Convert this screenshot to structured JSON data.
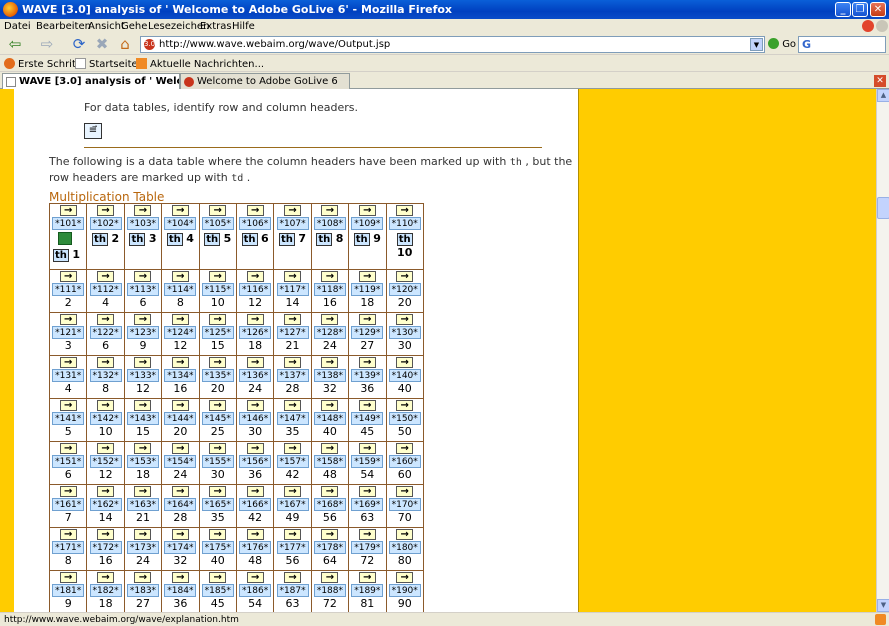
{
  "window": {
    "title": "WAVE [3.0] analysis of ' Welcome to Adobe GoLive 6' - Mozilla Firefox",
    "min": "_",
    "max": "❐",
    "close": "✕"
  },
  "menu": [
    "Datei",
    "Bearbeiten",
    "Ansicht",
    "Gehe",
    "Lesezeichen",
    "Extras",
    "Hilfe"
  ],
  "nav": {
    "back": "⇦",
    "forward": "⇨",
    "reload": "⟳",
    "stop": "✖",
    "home": "⌂",
    "url": "http://www.wave.webaim.org/wave/Output.jsp",
    "go_label": "Go",
    "search_logo": "G"
  },
  "bookmarks": [
    "Erste Schritte",
    "Startseite",
    "Aktuelle Nachrichten..."
  ],
  "tabs": [
    {
      "label": "WAVE [3.0] analysis of ' Welcome to A...",
      "active": true
    },
    {
      "label": "Welcome to Adobe GoLive 6",
      "active": false
    }
  ],
  "page": {
    "help_text": "For data tables, identify row and column headers.",
    "help_icon": "≡⃗",
    "para_before_th": "The following is a data table where the column headers have been marked up with ",
    "code_th": "th",
    "para_middle": " , but the row headers are marked up with ",
    "code_td": "td",
    "para_end": " .",
    "caption": "Multiplication Table",
    "arrow_glyph": "→",
    "th_label": "th",
    "header_row": {
      "ids": [
        "*101*",
        "*102*",
        "*103*",
        "*104*",
        "*105*",
        "*106*",
        "*107*",
        "*108*",
        "*109*",
        "*110*"
      ],
      "values": [
        "1",
        "2",
        "3",
        "4",
        "5",
        "6",
        "7",
        "8",
        "9",
        "10"
      ]
    },
    "rows": [
      {
        "ids": [
          "*111*",
          "*112*",
          "*113*",
          "*114*",
          "*115*",
          "*116*",
          "*117*",
          "*118*",
          "*119*",
          "*120*"
        ],
        "values": [
          "2",
          "4",
          "6",
          "8",
          "10",
          "12",
          "14",
          "16",
          "18",
          "20"
        ]
      },
      {
        "ids": [
          "*121*",
          "*122*",
          "*123*",
          "*124*",
          "*125*",
          "*126*",
          "*127*",
          "*128*",
          "*129*",
          "*130*"
        ],
        "values": [
          "3",
          "6",
          "9",
          "12",
          "15",
          "18",
          "21",
          "24",
          "27",
          "30"
        ]
      },
      {
        "ids": [
          "*131*",
          "*132*",
          "*133*",
          "*134*",
          "*135*",
          "*136*",
          "*137*",
          "*138*",
          "*139*",
          "*140*"
        ],
        "values": [
          "4",
          "8",
          "12",
          "16",
          "20",
          "24",
          "28",
          "32",
          "36",
          "40"
        ]
      },
      {
        "ids": [
          "*141*",
          "*142*",
          "*143*",
          "*144*",
          "*145*",
          "*146*",
          "*147*",
          "*148*",
          "*149*",
          "*150*"
        ],
        "values": [
          "5",
          "10",
          "15",
          "20",
          "25",
          "30",
          "35",
          "40",
          "45",
          "50"
        ]
      },
      {
        "ids": [
          "*151*",
          "*152*",
          "*153*",
          "*154*",
          "*155*",
          "*156*",
          "*157*",
          "*158*",
          "*159*",
          "*160*"
        ],
        "values": [
          "6",
          "12",
          "18",
          "24",
          "30",
          "36",
          "42",
          "48",
          "54",
          "60"
        ]
      },
      {
        "ids": [
          "*161*",
          "*162*",
          "*163*",
          "*164*",
          "*165*",
          "*166*",
          "*167*",
          "*168*",
          "*169*",
          "*170*"
        ],
        "values": [
          "7",
          "14",
          "21",
          "28",
          "35",
          "42",
          "49",
          "56",
          "63",
          "70"
        ]
      },
      {
        "ids": [
          "*171*",
          "*172*",
          "*173*",
          "*174*",
          "*175*",
          "*176*",
          "*177*",
          "*178*",
          "*179*",
          "*180*"
        ],
        "values": [
          "8",
          "16",
          "24",
          "32",
          "40",
          "48",
          "56",
          "64",
          "72",
          "80"
        ]
      },
      {
        "ids": [
          "*181*",
          "*182*",
          "*183*",
          "*184*",
          "*185*",
          "*186*",
          "*187*",
          "*188*",
          "*189*",
          "*190*"
        ],
        "values": [
          "9",
          "18",
          "27",
          "36",
          "45",
          "54",
          "63",
          "72",
          "81",
          "90"
        ]
      }
    ]
  },
  "status": {
    "text": "http://www.wave.webaim.org/wave/explanation.htm"
  },
  "colors": {
    "wave_yellow": "#ffcc00",
    "caption_orange": "#b8660c",
    "xp_blue": "#0040c0"
  }
}
